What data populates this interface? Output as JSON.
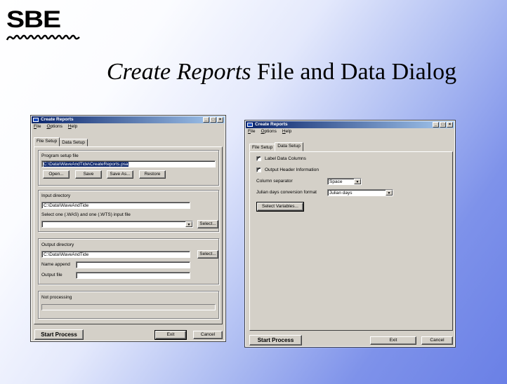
{
  "logo": {
    "text": "SBE"
  },
  "slide": {
    "title_italic": "Create Reports",
    "title_rest": " File and Data Dialog"
  },
  "window_left": {
    "title": "Create Reports",
    "menu": [
      "File",
      "Options",
      "Help"
    ],
    "tabs": [
      "File Setup",
      "Data Setup"
    ],
    "active_tab": "File Setup",
    "program_setup": {
      "label": "Program setup file",
      "value": "C:\\Data\\WaveAndTide\\CreateReports.psa",
      "buttons": [
        "Open...",
        "Save",
        "Save As...",
        "Restore"
      ]
    },
    "input": {
      "dir_label": "Input directory",
      "dir_value": "C:\\Data\\WaveAndTide",
      "file_label": "Select one (.WAS) and one (.WTS) input file",
      "file_value": "",
      "select_button": "Select..."
    },
    "output": {
      "dir_label": "Output directory",
      "dir_value": "C:\\Data\\WaveAndTide",
      "select_button": "Select...",
      "name_append_label": "Name append",
      "name_append_value": "",
      "output_file_label": "Output file",
      "output_file_value": ""
    },
    "status": {
      "label": "Not processing",
      "progress": 0
    },
    "start_button": "Start Process",
    "exit_button": "Exit",
    "cancel_button": "Cancel"
  },
  "window_right": {
    "title": "Create Reports",
    "menu": [
      "File",
      "Options",
      "Help"
    ],
    "tabs": [
      "File Setup",
      "Data Setup"
    ],
    "active_tab": "Data Setup",
    "label_data_columns": {
      "label": "Label Data Columns",
      "checked": true
    },
    "output_header": {
      "label": "Output Header Information",
      "checked": true
    },
    "column_separator": {
      "label": "Column separator",
      "value": "Space"
    },
    "julian": {
      "label": "Julian days conversion format",
      "value": "Julian days"
    },
    "select_variables_button": "Select Variables...",
    "start_button": "Start Process",
    "exit_button": "Exit",
    "cancel_button": "Cancel"
  },
  "colors": {
    "titlebar": "#0a246a",
    "dialog": "#d4d0c8",
    "slide_blue": "#6a80e6"
  },
  "icons": [
    "app-icon",
    "minimize-icon",
    "maximize-icon",
    "close-icon",
    "dropdown-arrow-icon",
    "checkmark-icon"
  ]
}
